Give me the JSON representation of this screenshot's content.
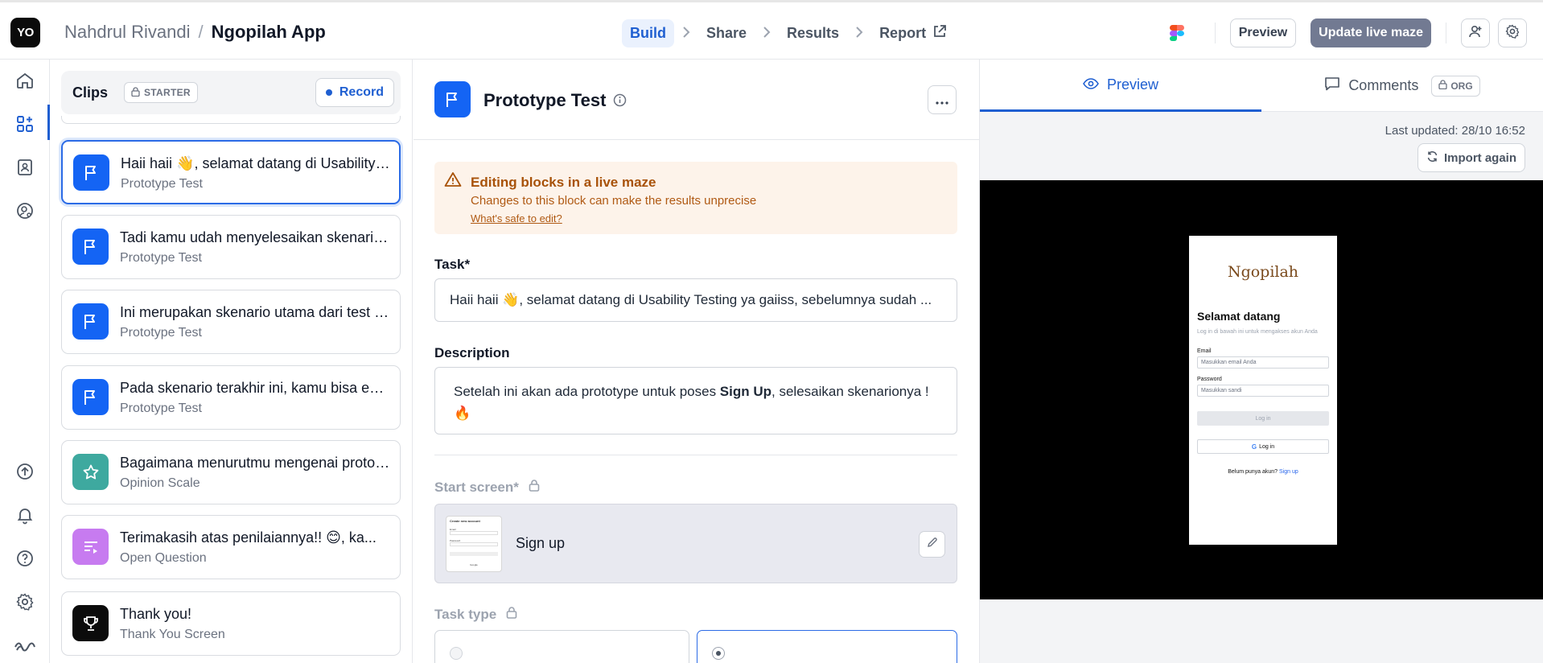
{
  "app": {
    "logo": "YO",
    "breadcrumb": {
      "owner": "Nahdrul Rivandi",
      "separator": "/",
      "project": "Ngopilah App"
    }
  },
  "steps": [
    {
      "label": "Build",
      "active": true
    },
    {
      "label": "Share",
      "active": false
    },
    {
      "label": "Results",
      "active": false
    },
    {
      "label": "Report",
      "active": false
    }
  ],
  "toolbar": {
    "preview_label": "Preview",
    "update_label": "Update live maze"
  },
  "rail": {
    "items": [
      "home-icon",
      "blocks-icon",
      "contacts-icon",
      "user-settings-icon",
      "upload-icon",
      "bell-icon",
      "help-icon",
      "gear-icon",
      "maze-logo-icon"
    ],
    "active": "blocks-icon"
  },
  "clips": {
    "title": "Clips",
    "badge": "STARTER",
    "record_label": "Record"
  },
  "blocks": [
    {
      "title": "Haii haii 👋, selamat datang di Usability Testing ya gaiiss, sebelumnya sudah ...",
      "type": "Prototype Test",
      "icon": "flag-icon",
      "color": "#1464f4",
      "selected": true
    },
    {
      "title": "Tadi kamu udah menyelesaikan skenario pertama nih ...",
      "type": "Prototype Test",
      "icon": "flag-icon",
      "color": "#1464f4",
      "selected": false
    },
    {
      "title": "Ini merupakan skenario utama dari test ini ...",
      "type": "Prototype Test",
      "icon": "flag-icon",
      "color": "#1464f4",
      "selected": false
    },
    {
      "title": "Pada skenario terakhir ini, kamu bisa eksplorasi ...",
      "type": "Prototype Test",
      "icon": "flag-icon",
      "color": "#1464f4",
      "selected": false
    },
    {
      "title": "Bagaimana menurutmu mengenai prototype ini ...",
      "type": "Opinion Scale",
      "icon": "star-icon",
      "color": "#3ea99f",
      "selected": false
    },
    {
      "title": "Terimakasih atas penilaiannya!! 😊, ka...",
      "type": "Open Question",
      "icon": "open-question-icon",
      "color": "#c77bf0",
      "selected": false
    },
    {
      "title": "Thank you!",
      "type": "Thank You Screen",
      "icon": "trophy-icon",
      "color": "#0b0b0b",
      "selected": false
    }
  ],
  "editor": {
    "title": "Prototype Test",
    "warning": {
      "title": "Editing blocks in a live maze",
      "description": "Changes to this block can make the results unprecise",
      "link": "What's safe to edit?"
    },
    "task_label": "Task*",
    "task_value": "Haii haii 👋, selamat datang di Usability Testing ya gaiiss, sebelumnya sudah ...",
    "description_label": "Description",
    "description_pre": "Setelah ini akan ada prototype untuk poses ",
    "description_bold": "Sign Up",
    "description_post": ", selesaikan skenarionya ! 🔥",
    "start_screen_label": "Start screen*",
    "start_screen_name": "Sign up",
    "task_type_label": "Task type"
  },
  "preview": {
    "tabs": [
      {
        "label": "Preview",
        "active": true
      },
      {
        "label": "Comments",
        "active": false,
        "badge": "ORG"
      }
    ],
    "last_updated": "Last updated: 28/10 16:52",
    "import_label": "Import again",
    "phone": {
      "logo": "Ngopilah",
      "heading": "Selamat datang",
      "subheading": "Log in di bawah ini untuk mengakses akun Anda",
      "email_label": "Email",
      "email_placeholder": "Masukkan email Anda",
      "password_label": "Password",
      "password_placeholder": "Masukkan sandi",
      "login_label": "Log in",
      "google_label": "Log in",
      "footer_text": "Belum punya akun?",
      "footer_link": "Sign up"
    },
    "thumb": {
      "heading": "Create new account",
      "field1": "Email",
      "field2": "Password",
      "button": "Google"
    }
  },
  "colors": {
    "accent": "#1f5fd1",
    "update_button": "#727a92",
    "warning_bg": "#fdf3ea",
    "warning_text": "#a85209"
  }
}
